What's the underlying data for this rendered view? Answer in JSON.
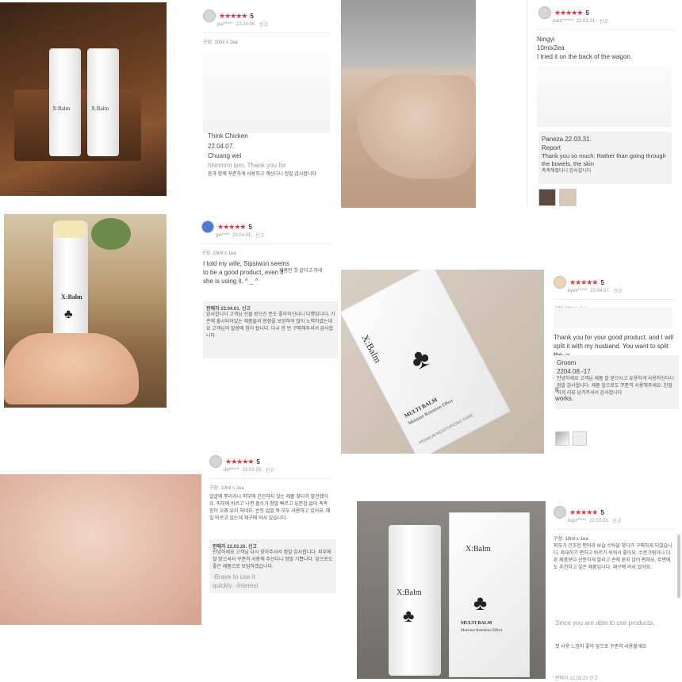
{
  "tile1": {
    "user": "pai*****",
    "date": "22.04.06.",
    "report": "신고",
    "score": "5",
    "option": "구성: 10ml x 2ea",
    "trans_author": "Think Chicken",
    "trans_date": "22.04.07.",
    "trans_name": "Chuang wei",
    "trans_text": "hhinmmi ipm. Thank you for",
    "reply_text": "혼과 함께 꾸준하게 사용하고 계신다니 정말 감사합니다"
  },
  "tile2": {
    "user": "park******",
    "date": "22.03.31.",
    "report": "신고",
    "score": "5",
    "trans_option": "Ningyi",
    "trans_option2": "10mlx2ea",
    "trans_review": "I tried it on the back of the wagon.",
    "reply_author": "Paneza 22.03.31.",
    "reply_report": "Report",
    "reply_text": "Thank you so much. Rather than going through the bowels, the skin",
    "reply_tail": "촉촉해졌다니 감사합니다"
  },
  "tile3": {
    "user": "gw****",
    "date": "22.04.01.",
    "report": "신고",
    "score": "5",
    "option": "구성: 10ml x 1ea",
    "review_en": "I told my wife, Sipsiwon seems to be a good product, even if she is using it. ^ _ ^",
    "review_ko_tail": "제품인 것 같다고 하네",
    "reply_head": "판매자  22.04.01.  신고",
    "reply_text": "감사합니다 고객님 선물 받으신 분도 좋아하신다니 다행입니다. 기존에 출시되어있는 제품들의 장점을 보완하여 많이 노력하였는데요 고객님의 말씀에 힘이 됩니다. 다시 한 번 구매해주셔서 감사합니다"
  },
  "tile4": {
    "user": "kyee*****",
    "date": "22.04.07.",
    "report": "신고",
    "score": "5",
    "option": "구성: 10ml x 1ea",
    "trans_review": "Thank you for your good product, and I will split it with my husband. You want to split the",
    "trans_review2": "burn?",
    "trans_reply_author": "Groom",
    "trans_reply_date": "2204.08.-17",
    "reply_text": "안녕하세요 고객님 제품 잘 받으시고 유용하게 사용하신다니 정말 감사합니다. 제품 앞으로도 꾸준히 사용해주세요. 친절하게 리뷰 남겨주셔서 감사합니다",
    "trans_tail1": "it",
    "trans_tail2": "works."
  },
  "tile5": {
    "user": "dkf*****",
    "date": "22.03.26.",
    "report": "신고",
    "score": "5",
    "option": "구성: 10ml x 2ea",
    "review_ko": "얼굴에 뿌리거나 피부에 끈끈하지 않는 제품 찾다가 발견했어요. 피부에 바르고 나면 흡수가 정말 빠르고 유분감 없이 촉촉함이 오래 유지 되네요. 손등 얼굴 목 모두 사용하고 있어요. 매일 바르고 있는데 재구매 의사 있습니다.",
    "reply_head": "판매자  22.03.26.  신고",
    "reply_text": "안녕하세요 고객님 다시 찾아주셔서 정말 감사합니다. 피부에 잘 맞으셔서 꾸준히 사용해 주신다니 정말 기쁩니다. 앞으로도 좋은 제품으로 보답하겠습니다.",
    "trans_text": "-Brave to use it quickly. -Interest"
  },
  "tile6": {
    "user": "bigo*****",
    "date": "22.03.23.",
    "report": "신고",
    "score": "5",
    "review_ko": "구성: 10ml x 1ea\n피부가 건조한 편이라 보습 스틱을 찾다가 구매하게 되었습니다. 휴대하기 편하고 바르기 쉬워서 좋아요. 수분크림이나 다른 제품보다 산뜻하게 발리고 손에 묻지 않아 편해요. 주변에도 추천하고 싶은 제품입니다. 재구매 의사 있어요.",
    "trans_text": "Since you are able to use products,",
    "footer": "첫 사용 느낌이 좋아 앞으로 꾸준히 사용할게요",
    "footer2": "판매자 22.03.23 신고"
  },
  "product": {
    "brand": "X:Balm",
    "name": "MULTI BALM",
    "tagline": "Moisture Retention Effect",
    "sub": "PREMIUM MOISTURIZING CARE"
  },
  "stars": "★★★★★"
}
